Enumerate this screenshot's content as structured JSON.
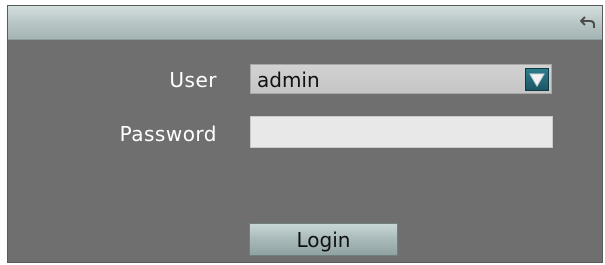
{
  "titlebar": {
    "back_icon": "back-arrow-icon"
  },
  "form": {
    "user_label": "User",
    "user_value": "admin",
    "dropdown_icon": "dropdown-arrow-icon",
    "password_label": "Password",
    "password_value": ""
  },
  "actions": {
    "login_label": "Login"
  },
  "colors": {
    "background": "#6f6f6f",
    "titlebar": "#b6c5c4",
    "dropdown_arrow": "#2d7d8d"
  }
}
